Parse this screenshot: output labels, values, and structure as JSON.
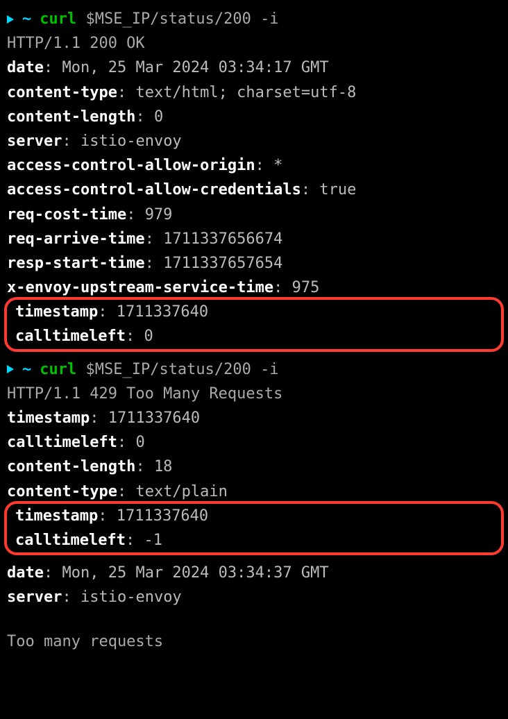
{
  "req1": {
    "prompt_tilde": "~",
    "cmd": "curl",
    "args": "$MSE_IP/status/200 -i",
    "status": "HTTP/1.1 200 OK",
    "headers": [
      {
        "k": "date",
        "v": "Mon, 25 Mar 2024 03:34:17 GMT"
      },
      {
        "k": "content-type",
        "v": "text/html; charset=utf-8"
      },
      {
        "k": "content-length",
        "v": "0"
      },
      {
        "k": "server",
        "v": "istio-envoy"
      },
      {
        "k": "access-control-allow-origin",
        "v": "*"
      },
      {
        "k": "access-control-allow-credentials",
        "v": "true"
      },
      {
        "k": "req-cost-time",
        "v": "979"
      },
      {
        "k": "req-arrive-time",
        "v": "1711337656674"
      },
      {
        "k": "resp-start-time",
        "v": "1711337657654"
      },
      {
        "k": "x-envoy-upstream-service-time",
        "v": "975"
      }
    ],
    "boxed": [
      {
        "k": "timestamp",
        "v": "1711337640"
      },
      {
        "k": "calltimeleft",
        "v": "0"
      }
    ]
  },
  "req2": {
    "prompt_tilde": "~",
    "cmd": "curl",
    "args": "$MSE_IP/status/200 -i",
    "status": "HTTP/1.1 429 Too Many Requests",
    "headers1": [
      {
        "k": "timestamp",
        "v": "1711337640"
      },
      {
        "k": "calltimeleft",
        "v": "0"
      },
      {
        "k": "content-length",
        "v": "18"
      },
      {
        "k": "content-type",
        "v": "text/plain"
      }
    ],
    "boxed": [
      {
        "k": "timestamp",
        "v": "1711337640"
      },
      {
        "k": "calltimeleft",
        "v": "-1"
      }
    ],
    "headers2": [
      {
        "k": "date",
        "v": "Mon, 25 Mar 2024 03:34:37 GMT"
      },
      {
        "k": "server",
        "v": "istio-envoy"
      }
    ],
    "body": "Too many requests"
  }
}
